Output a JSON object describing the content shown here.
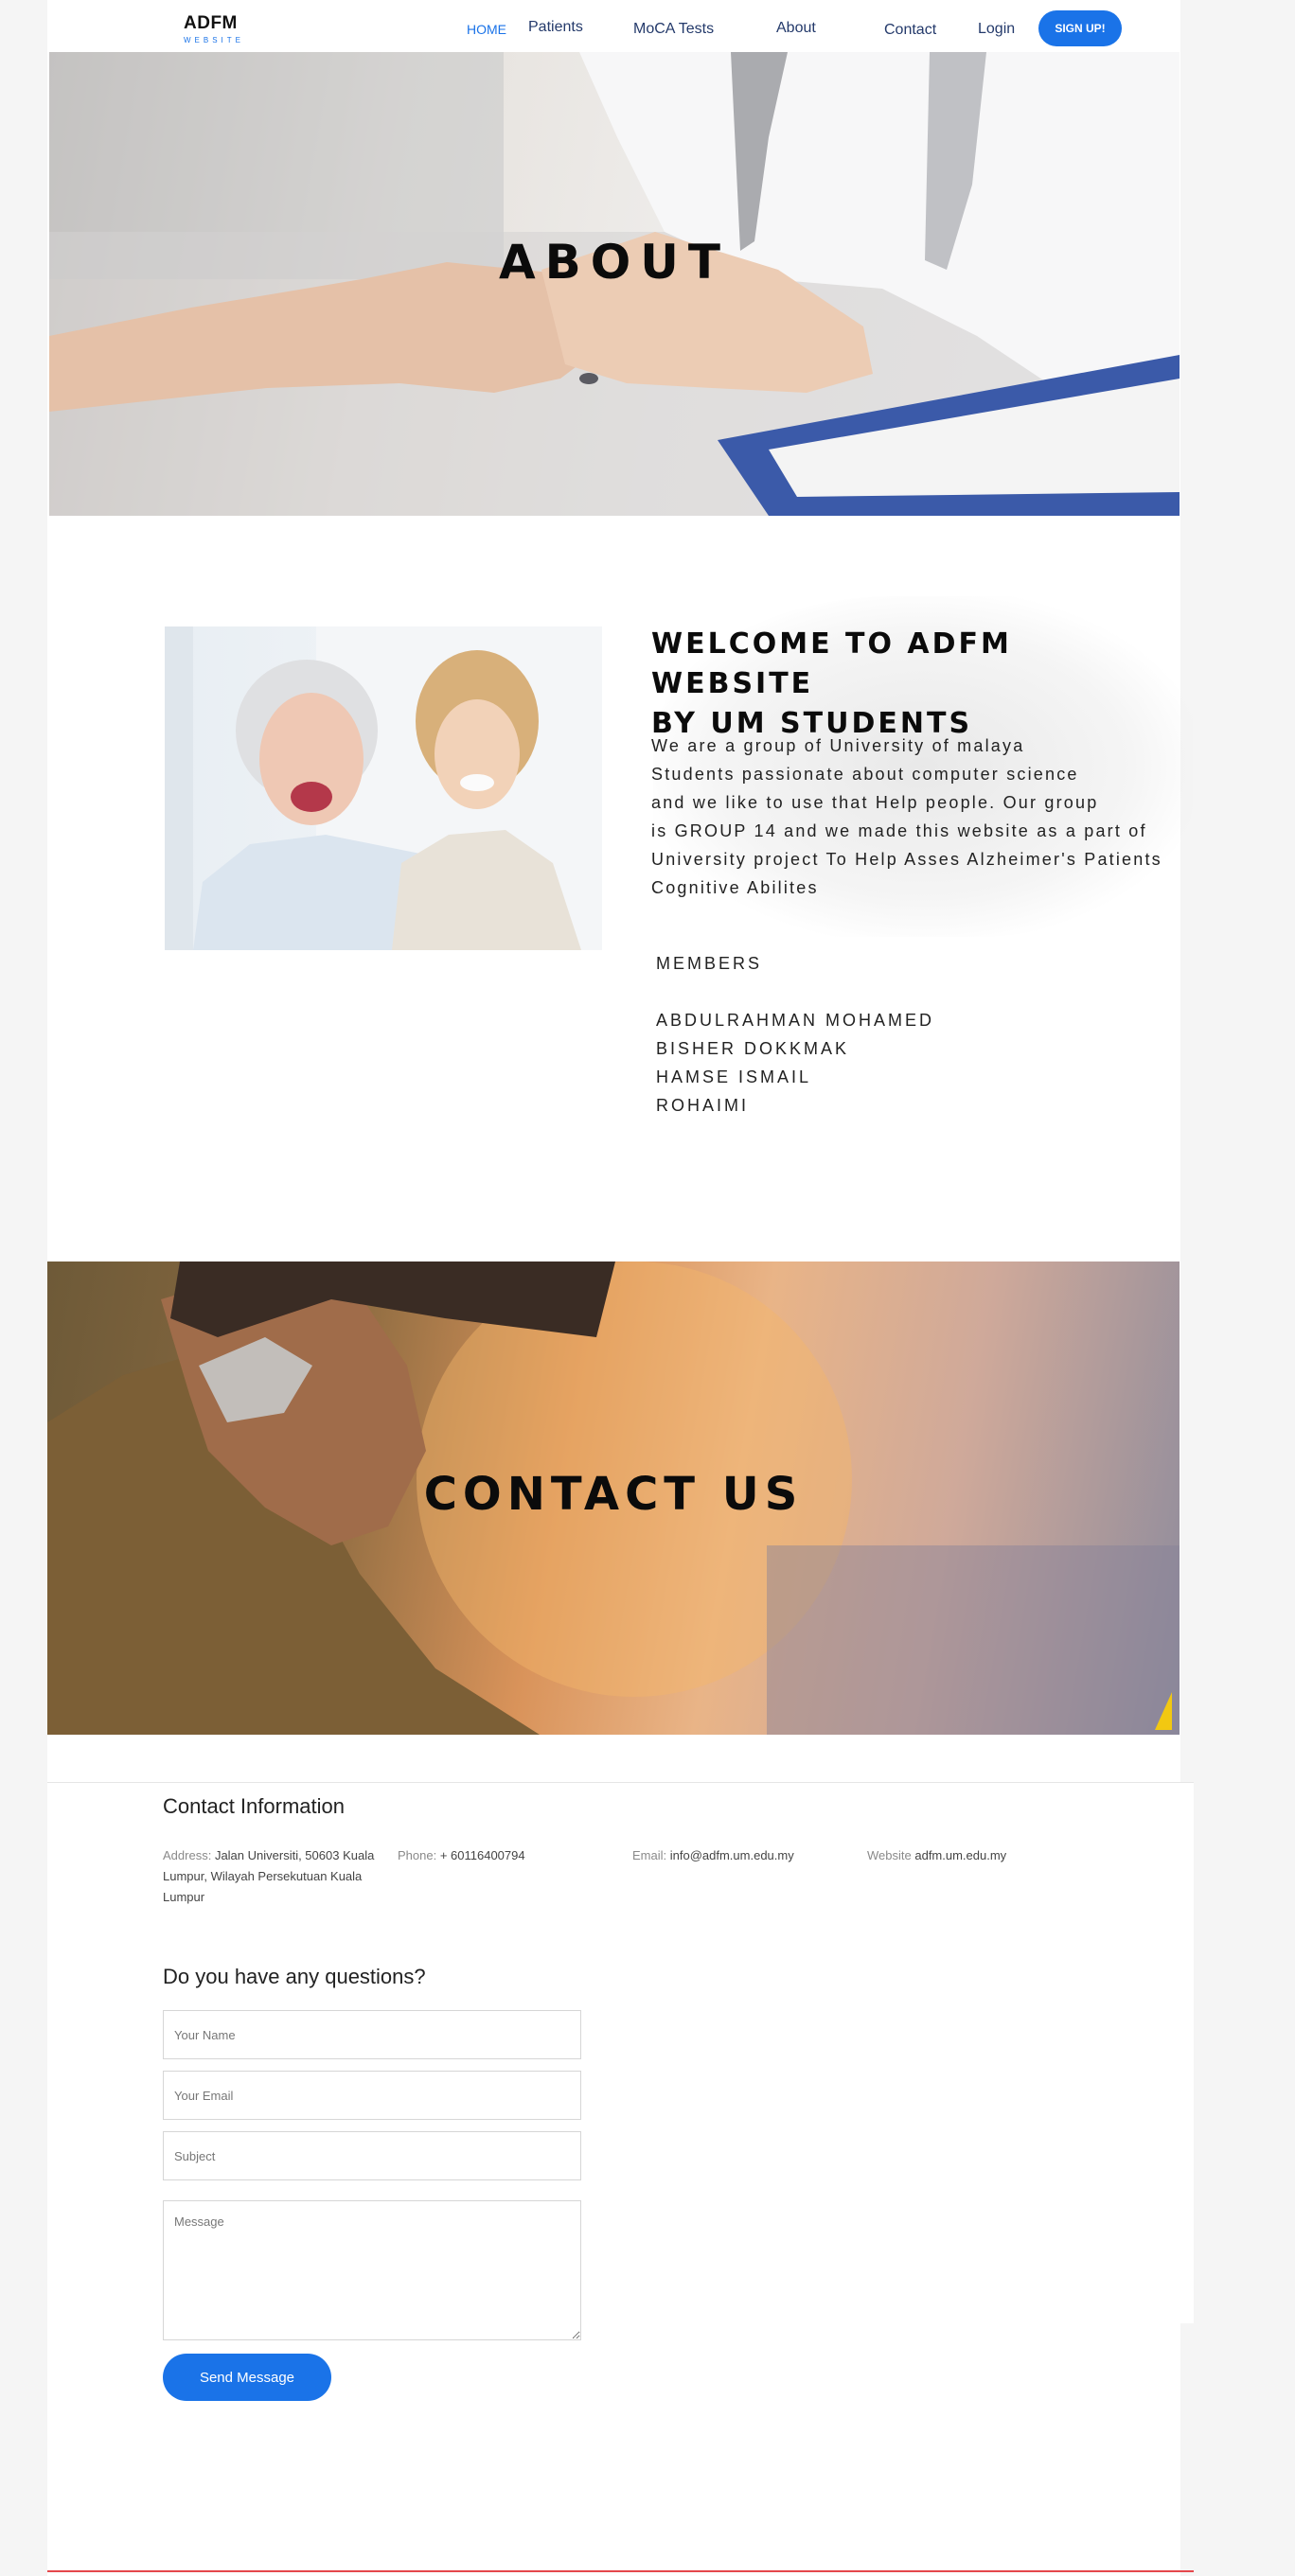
{
  "header": {
    "logo_main": "ADFM",
    "logo_sub": "WEBSITE",
    "nav": [
      {
        "label": "HOME",
        "active": true
      },
      {
        "label": "Patients"
      },
      {
        "label": "MoCA Tests"
      },
      {
        "label": "About"
      },
      {
        "label": "Contact"
      },
      {
        "label": "Login"
      }
    ],
    "signup_label": "SIGN UP!"
  },
  "about_hero": {
    "title": "ABOUT"
  },
  "welcome": {
    "title_line1": "WELCOME TO ADFM WEBSITE",
    "title_line2": "BY UM STUDENTS",
    "text_lines": [
      "We are a group of University of malaya",
      "Students passionate about computer science",
      "and we like to use that Help people. Our group",
      "is GROUP 14 and we made this website as a part of",
      "University project To Help Asses Alzheimer's Patients",
      "Cognitive Abilites"
    ],
    "members_title": "MEMBERS",
    "members": [
      "ABDULRAHMAN MOHAMED",
      "BISHER DOKKMAK",
      "HAMSE ISMAIL",
      "ROHAIMI"
    ]
  },
  "contact_hero": {
    "title": "CONTACT US"
  },
  "contact_info": {
    "title": "Contact Information",
    "address_label": "Address:",
    "address_line1": "Jalan Universiti, 50603 Kuala",
    "address_line2": "Lumpur, Wilayah Persekutuan Kuala",
    "address_line3": "Lumpur",
    "phone_label": "Phone:",
    "phone": "+ 60116400794",
    "email_label": "Email:",
    "email": "info@adfm.um.edu.my",
    "website_label": "Website",
    "website": "adfm.um.edu.my"
  },
  "form": {
    "title": "Do you have any questions?",
    "name_placeholder": "Your Name",
    "email_placeholder": "Your Email",
    "subject_placeholder": "Subject",
    "message_placeholder": "Message",
    "send_label": "Send Message"
  },
  "colors": {
    "accent": "#1a73e8",
    "footer_line": "#e5484d",
    "nav_text": "#243a6b"
  }
}
